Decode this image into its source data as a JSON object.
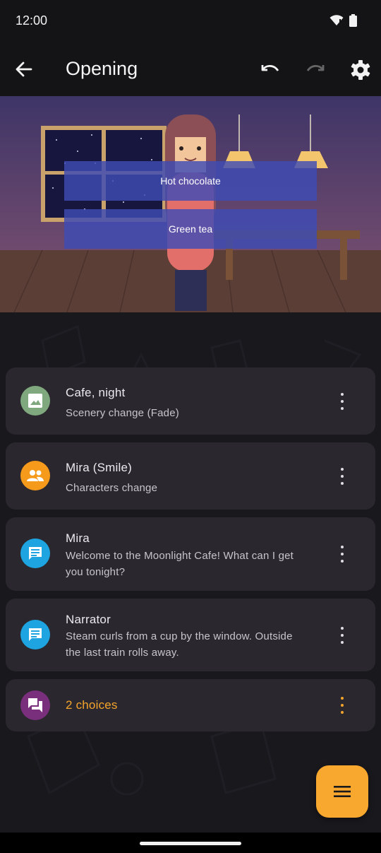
{
  "status_bar": {
    "time": "12:00",
    "icons": [
      "wifi-icon",
      "battery-icon"
    ]
  },
  "app_bar": {
    "title": "Opening",
    "icons": [
      "back-arrow-icon",
      "undo-icon",
      "redo-icon",
      "gear-icon"
    ]
  },
  "preview": {
    "choices": [
      {
        "label": "Hot chocolate"
      },
      {
        "label": "Green tea"
      }
    ]
  },
  "events": [
    {
      "title": "Cafe, night",
      "subtitle": "Scenery change (Fade)",
      "icon": "image-icon",
      "icon_color": "#7fa87e"
    },
    {
      "title": "Mira (Smile)",
      "subtitle": "Characters change",
      "icon": "people-icon",
      "icon_color": "#f59a1b"
    },
    {
      "title": "Mira",
      "subtitle": "Welcome to the Moonlight Cafe! What can I get you tonight?",
      "icon": "message-icon",
      "icon_color": "#1ea4e0"
    },
    {
      "title": "Narrator",
      "subtitle": "Steam curls from a cup by the window. Outside the last train rolls away.",
      "icon": "message-icon",
      "icon_color": "#1ea4e0"
    },
    {
      "title": "2 choices",
      "icon": "chat-choices-icon",
      "icon_color": "#7a2f7c",
      "title_color": "#f5a42c"
    }
  ],
  "fab": {
    "icon": "menu-icon",
    "color": "#f9a82f"
  }
}
